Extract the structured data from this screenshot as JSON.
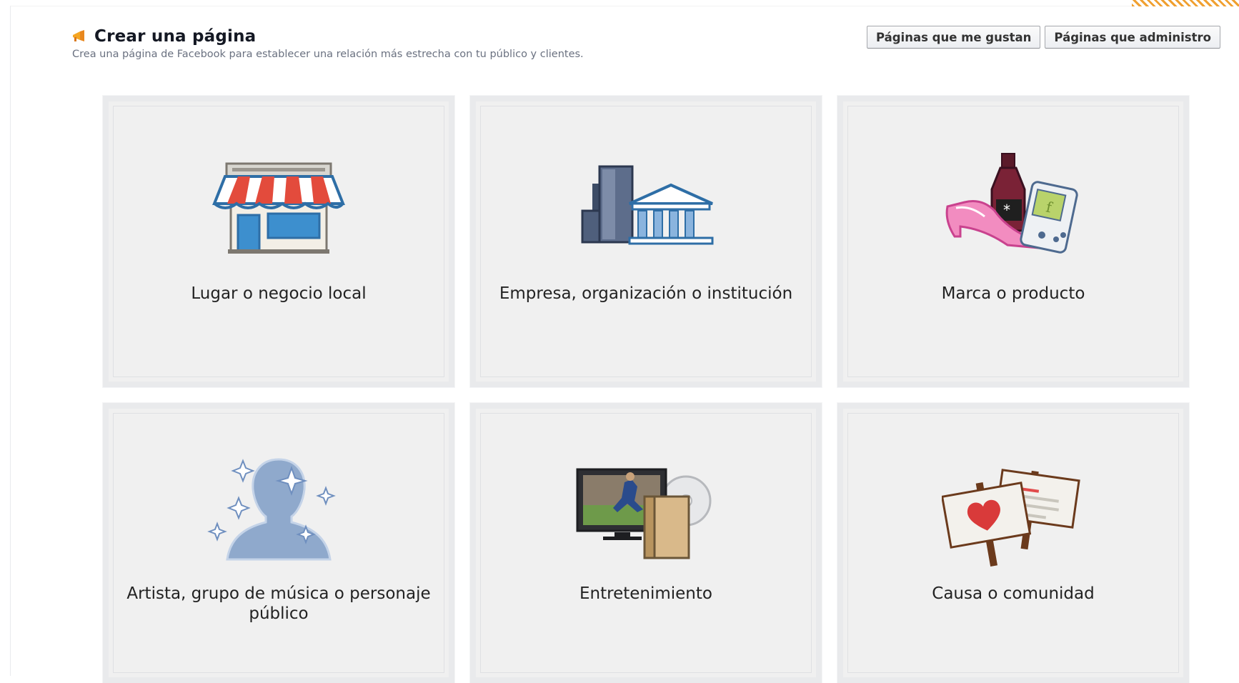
{
  "header": {
    "title": "Crear una página",
    "subtitle": "Crea una página de Facebook para establecer una relación más estrecha con tu público y clientes.",
    "flag_icon": "megaphone-icon"
  },
  "buttons": {
    "liked_pages": "Páginas que me gustan",
    "managed_pages": "Páginas que administro"
  },
  "categories": [
    {
      "label": "Lugar o negocio local",
      "icon": "storefront-icon"
    },
    {
      "label": "Empresa, organización o institución",
      "icon": "building-icon"
    },
    {
      "label": "Marca o producto",
      "icon": "products-icon"
    },
    {
      "label": "Artista, grupo de música o personaje público",
      "icon": "person-sparkles-icon"
    },
    {
      "label": "Entretenimiento",
      "icon": "tv-media-icon"
    },
    {
      "label": "Causa o comunidad",
      "icon": "signs-icon"
    }
  ],
  "colors": {
    "tile_bg": "#f0f0f0",
    "tile_border": "#e9eaec",
    "accent_orange": "#f0a030",
    "text": "#141823",
    "subtitle": "#6a7180"
  }
}
